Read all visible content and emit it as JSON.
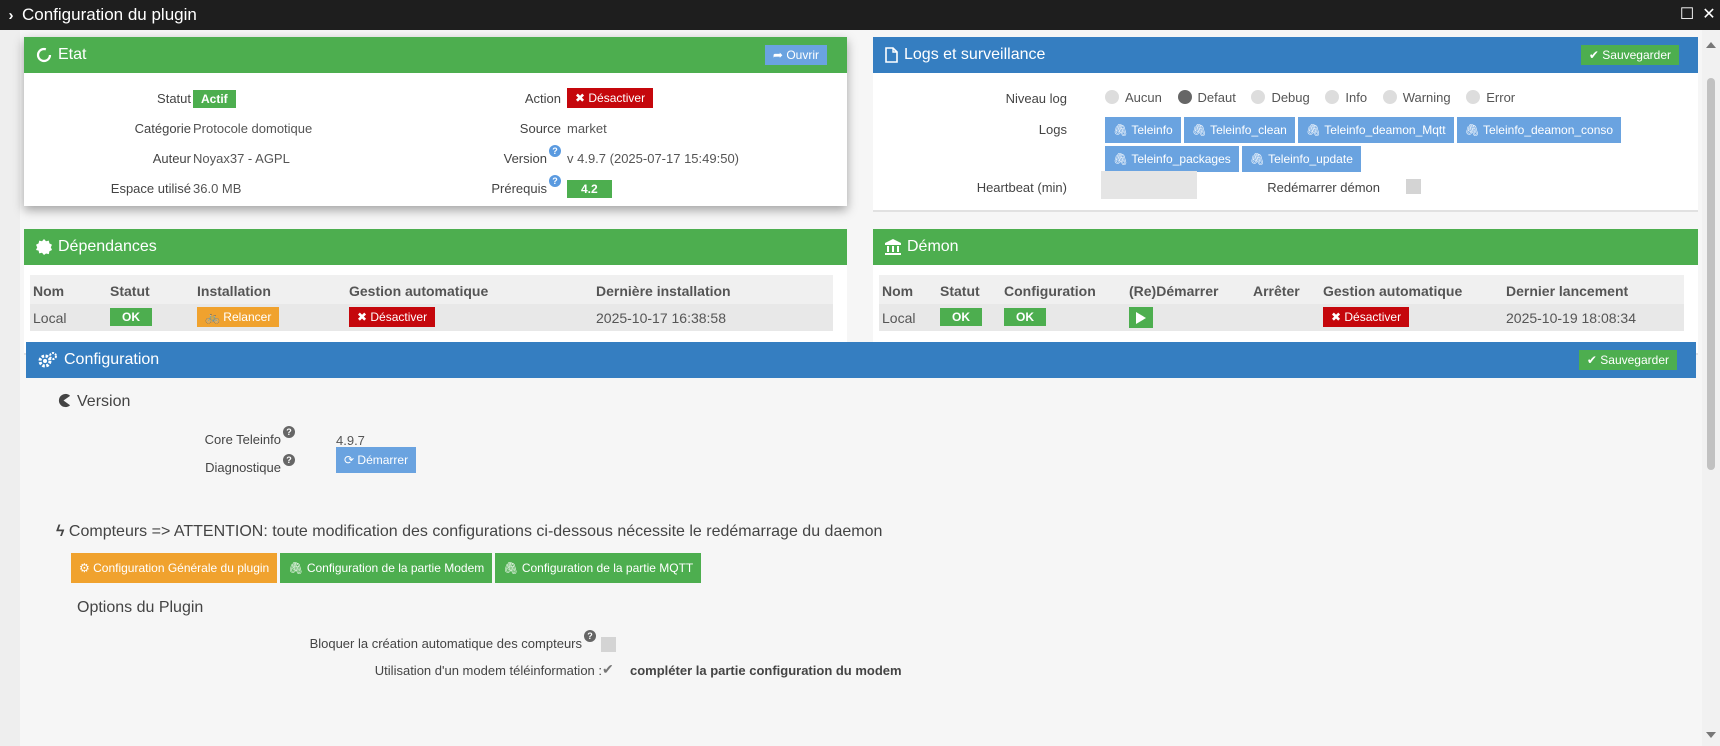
{
  "window": {
    "title": "Configuration du plugin"
  },
  "etat": {
    "title": "Etat",
    "open_label": "Ouvrir",
    "statut_label": "Statut",
    "statut_value": "Actif",
    "categorie_label": "Catégorie",
    "categorie_value": "Protocole domotique",
    "auteur_label": "Auteur",
    "auteur_value": "Noyax37 - AGPL",
    "espace_label": "Espace utilisé",
    "espace_value": "36.0 MB",
    "action_label": "Action",
    "action_button": "Désactiver",
    "source_label": "Source",
    "source_value": "market",
    "version_label": "Version",
    "version_value": "v 4.9.7 (2025-07-17 15:49:50)",
    "prerequis_label": "Prérequis",
    "prerequis_value": "4.2"
  },
  "logs": {
    "title": "Logs et surveillance",
    "save_label": "Sauvegarder",
    "niveau_label": "Niveau log",
    "levels": [
      "Aucun",
      "Defaut",
      "Debug",
      "Info",
      "Warning",
      "Error"
    ],
    "selected_level": "Defaut",
    "logs_label": "Logs",
    "log_buttons": [
      "Teleinfo",
      "Teleinfo_clean",
      "Teleinfo_deamon_Mqtt",
      "Teleinfo_deamon_conso",
      "Teleinfo_packages",
      "Teleinfo_update"
    ],
    "heartbeat_label": "Heartbeat (min)",
    "heartbeat_value": "",
    "restart_label": "Redémarrer démon"
  },
  "dependances": {
    "title": "Dépendances",
    "headers": [
      "Nom",
      "Statut",
      "Installation",
      "Gestion automatique",
      "Dernière installation"
    ],
    "row": {
      "nom": "Local",
      "statut": "OK",
      "installation": "Relancer",
      "gestion": "Désactiver",
      "derniere": "2025-10-17 16:38:58"
    }
  },
  "demon": {
    "title": "Démon",
    "headers": [
      "Nom",
      "Statut",
      "Configuration",
      "(Re)Démarrer",
      "Arrêter",
      "Gestion automatique",
      "Dernier lancement"
    ],
    "row": {
      "nom": "Local",
      "statut": "OK",
      "configuration": "OK",
      "gestion": "Désactiver",
      "dernier": "2025-10-19 18:08:34"
    }
  },
  "configuration": {
    "title": "Configuration",
    "save_label": "Sauvegarder",
    "version_heading": "Version",
    "core_label": "Core Teleinfo",
    "core_value": "4.9.7",
    "diag_label": "Diagnostique",
    "diag_button": "Démarrer",
    "compteurs_heading": "Compteurs => ATTENTION: toute modification des configurations ci-dessous nécessite le redémarrage du daemon",
    "tabs": [
      "Configuration Générale du plugin",
      "Configuration de la partie Modem",
      "Configuration de la partie MQTT"
    ],
    "options_heading": "Options du Plugin",
    "bloquer_label": "Bloquer la création automatique des compteurs",
    "modem_label": "Utilisation d'un modem téléinformation :",
    "modem_hint": "compléter la partie configuration du modem"
  },
  "colors": {
    "green": "#4dae4f",
    "blue": "#357ec1",
    "red": "#c5070c",
    "orange": "#f0a22e",
    "light_blue": "#6aa3e0"
  }
}
